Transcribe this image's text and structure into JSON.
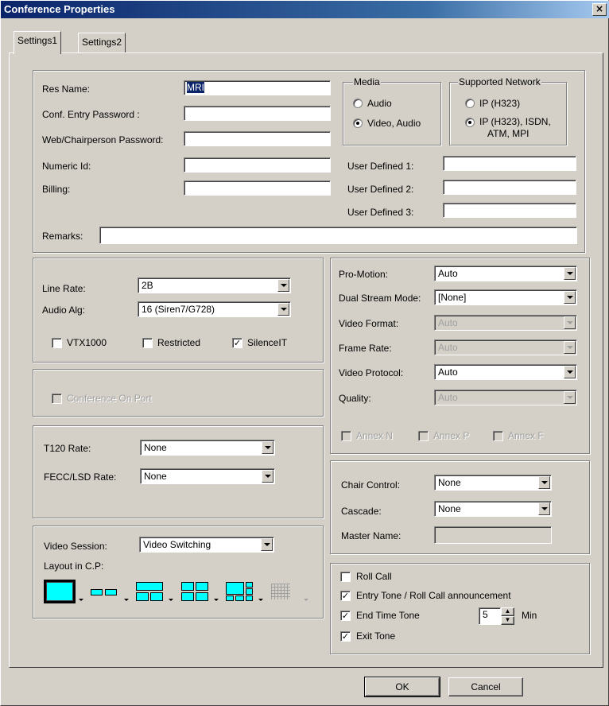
{
  "window": {
    "title": "Conference Properties",
    "close_glyph": "×"
  },
  "tabs": [
    {
      "label": "Settings1"
    },
    {
      "label": "Settings2"
    }
  ],
  "general": {
    "res_name_label": "Res Name:",
    "res_name_value": "MRI",
    "entry_password_label": "Conf. Entry Password :",
    "entry_password_value": "",
    "web_password_label": "Web/Chairperson Password:",
    "web_password_value": "",
    "numeric_id_label": "Numeric Id:",
    "numeric_id_value": "",
    "billing_label": "Billing:",
    "billing_value": "",
    "remarks_label": "Remarks:",
    "remarks_value": "",
    "user1_label": "User Defined 1:",
    "user1_value": "",
    "user2_label": "User Defined 2:",
    "user2_value": "",
    "user3_label": "User Defined 3:",
    "user3_value": ""
  },
  "media": {
    "title": "Media",
    "audio_label": "Audio",
    "video_audio_label": "Video, Audio",
    "selected": "Video, Audio"
  },
  "network": {
    "title": "Supported Network",
    "ip_label": "IP (H323)",
    "ip_isdn_label": "IP (H323), ISDN,",
    "ip_isdn_label2": "ATM, MPI",
    "selected": "IP (H323), ISDN, ATM, MPI"
  },
  "line": {
    "line_rate_label": "Line Rate:",
    "line_rate_value": "2B",
    "audio_alg_label": "Audio Alg:",
    "audio_alg_value": "16 (Siren7/G728)",
    "vtx_label": "VTX1000",
    "vtx_checked": false,
    "restricted_label": "Restricted",
    "restricted_checked": false,
    "silence_label": "SilenceIT",
    "silence_checked": true
  },
  "conf_on_port": {
    "label": "Conference On Port",
    "checked": false
  },
  "rates": {
    "t120_label": "T120 Rate:",
    "t120_value": "None",
    "fecc_label": "FECC/LSD Rate:",
    "fecc_value": "None"
  },
  "video_session": {
    "label": "Video Session:",
    "value": "Video Switching",
    "layout_label": "Layout in C.P:"
  },
  "video": {
    "promotion_label": "Pro-Motion:",
    "promotion_value": "Auto",
    "dual_label": "Dual Stream Mode:",
    "dual_value": "[None]",
    "format_label": "Video Format:",
    "format_value": "Auto",
    "frame_label": "Frame Rate:",
    "frame_value": "Auto",
    "protocol_label": "Video Protocol:",
    "protocol_value": "Auto",
    "quality_label": "Quality:",
    "quality_value": "Auto",
    "annex_n": "Annex N",
    "annex_p": "Annex P",
    "annex_f": "Annex F"
  },
  "chair": {
    "chair_label": "Chair Control:",
    "chair_value": "None",
    "cascade_label": "Cascade:",
    "cascade_value": "None",
    "master_label": "Master Name:",
    "master_value": ""
  },
  "tones": {
    "roll_call_label": "Roll Call",
    "roll_call_checked": false,
    "entry_tone_label": "Entry Tone / Roll Call announcement",
    "entry_tone_checked": true,
    "end_time_label": "End Time Tone",
    "end_time_checked": true,
    "end_time_value": "5",
    "min_label": "Min",
    "exit_tone_label": "Exit Tone",
    "exit_tone_checked": true
  },
  "buttons": {
    "ok": "OK",
    "cancel": "Cancel"
  },
  "colors": {
    "face": "#d4d0c8",
    "title_start": "#0a246a",
    "title_end": "#a6caf0",
    "layout_selected": "#00ffff"
  }
}
